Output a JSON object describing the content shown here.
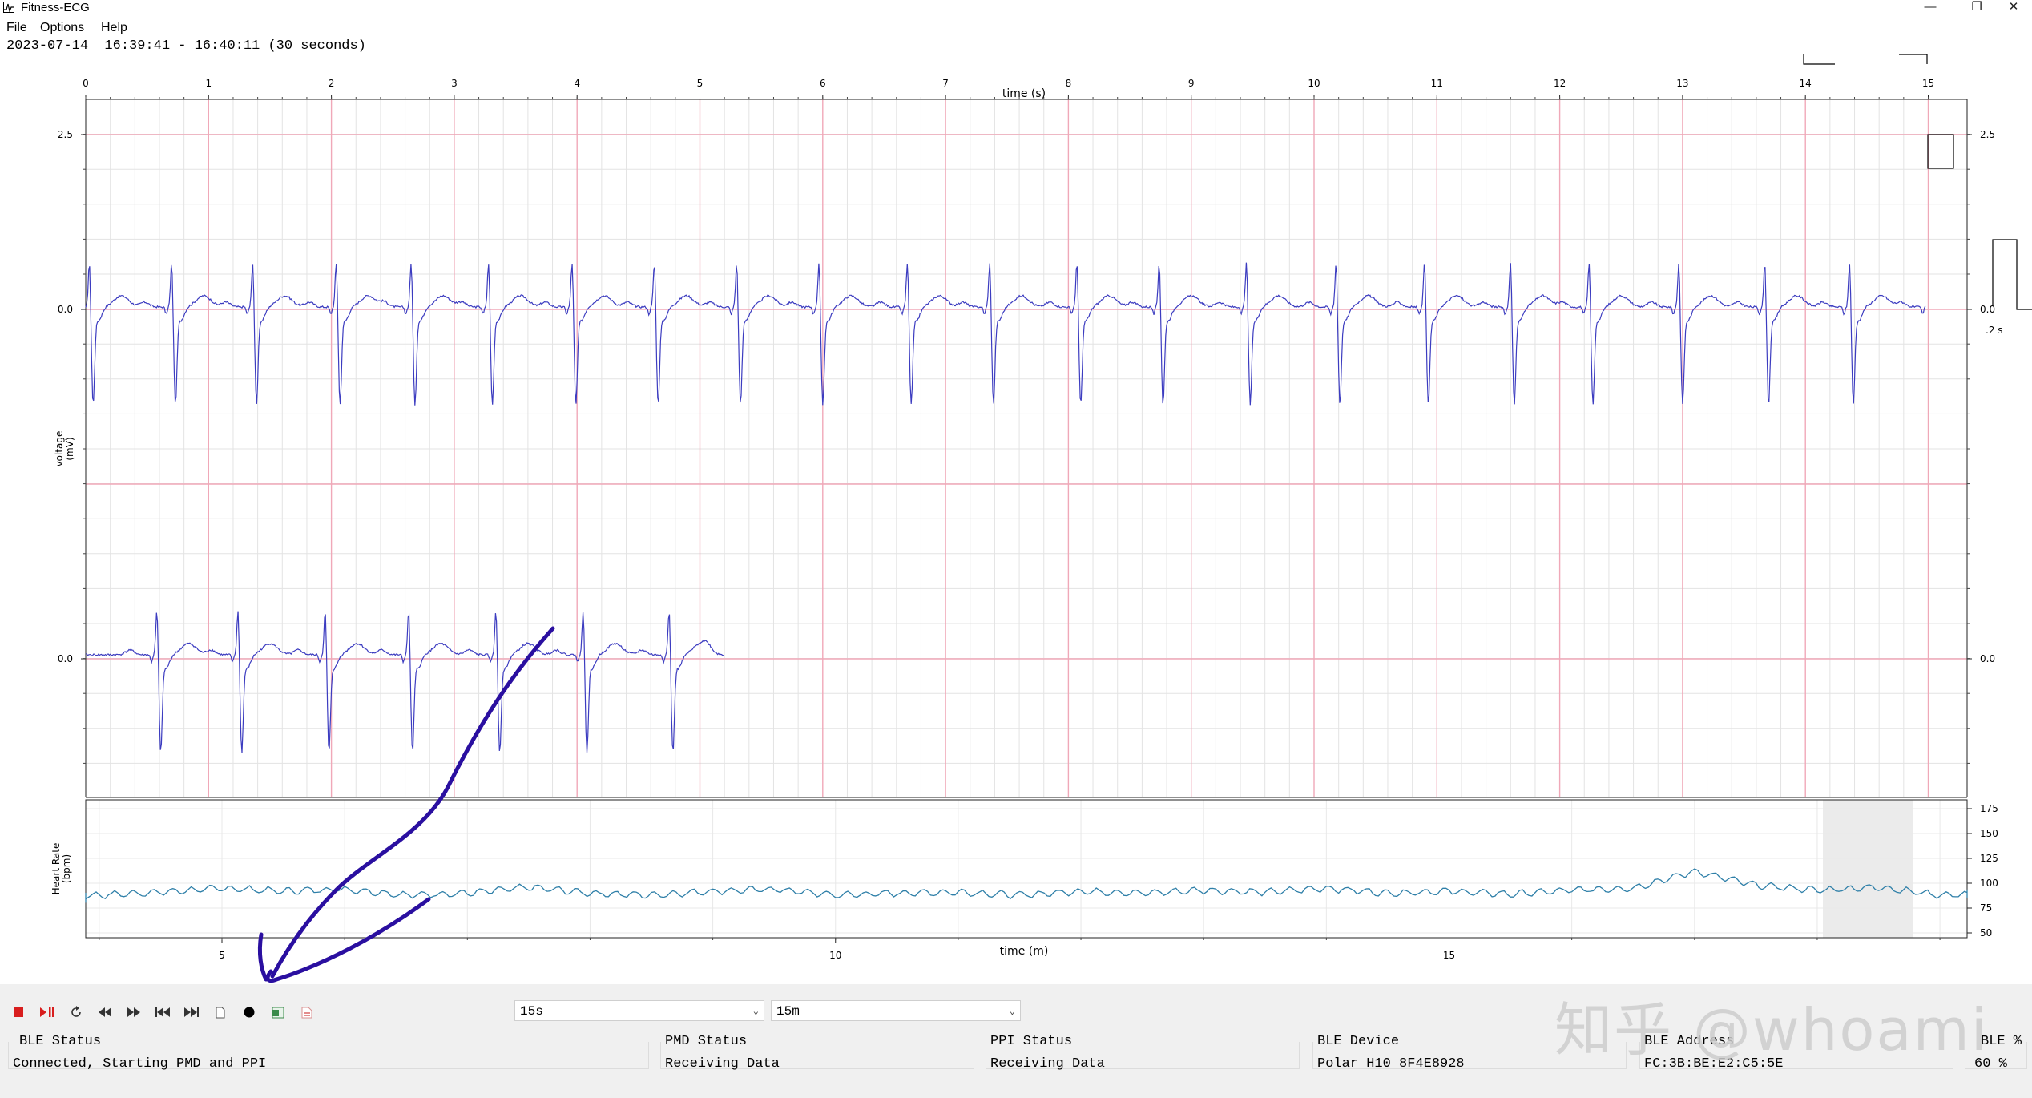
{
  "window": {
    "title": "Fitness-ECG",
    "controls": {
      "minimize": "—",
      "restore": "❐",
      "close": "✕"
    }
  },
  "menu": {
    "items": [
      "File",
      "Options",
      "Help"
    ]
  },
  "session_info": "2023-07-14  16:39:41 - 16:40:11 (30 seconds)",
  "ecg_plot": {
    "xlabel": "time (s)",
    "ylabel": "voltage\n(mV)",
    "x_ticks": [
      "0",
      "1",
      "2",
      "3",
      "4",
      "5",
      "6",
      "7",
      "8",
      "9",
      "10",
      "11",
      "12",
      "13",
      "14",
      "15"
    ],
    "y_tick_labels": [
      "2.5",
      "0.0",
      "0.0"
    ],
    "right_tick_labels": [
      "2.5",
      "0.0",
      "0.0"
    ],
    "calibration_label": ".2 s"
  },
  "hr_plot": {
    "xlabel": "time (m)",
    "ylabel": "Heart Rate\n(bpm)",
    "x_ticks": [
      "5",
      "10",
      "15"
    ],
    "y_ticks": [
      "175",
      "150",
      "125",
      "100",
      "75",
      "50"
    ]
  },
  "chart_data": [
    {
      "type": "line",
      "title": "",
      "xlabel": "time (s)",
      "ylabel": "voltage (mV)",
      "xlim": [
        0,
        15
      ],
      "series": [
        {
          "name": "",
          "x_range": [
            0,
            15
          ],
          "baseline_mV": 0.0,
          "beats_per_15s": 23
        },
        {
          "name": "",
          "x_range": [
            0,
            5.2
          ],
          "baseline_mV": 0.0,
          "beats": 8
        }
      ],
      "grid": true
    },
    {
      "type": "line",
      "title": "",
      "xlabel": "time (m)",
      "ylabel": "Heart Rate (bpm)",
      "ylim": [
        40,
        180
      ],
      "x": [
        2.8,
        3.5,
        4.0,
        4.5,
        5.0,
        5.5,
        6.0,
        6.5,
        7.0,
        7.5,
        8.0,
        8.5,
        9.0,
        9.5,
        10.0,
        10.5,
        11.0,
        11.5,
        12.0,
        12.5,
        13.0,
        13.5,
        14.0,
        14.5,
        15.0,
        15.5,
        16.0,
        16.5,
        17.0,
        17.5,
        18.0,
        18.5,
        19.0,
        19.5,
        20.0
      ],
      "series": [
        {
          "name": "",
          "values": [
            83,
            85,
            88,
            91,
            95,
            92,
            94,
            88,
            90,
            96,
            90,
            88,
            92,
            94,
            88,
            90,
            91,
            88,
            92,
            90,
            93,
            91,
            95,
            90,
            92,
            89,
            93,
            95,
            112,
            98,
            93,
            96,
            88,
            90,
            88
          ]
        }
      ],
      "grid": true
    }
  ],
  "toolbar": {
    "buttons": [
      "stop",
      "play-pause",
      "refresh",
      "rewind",
      "fast-forward",
      "skip-start",
      "skip-end",
      "new-file",
      "record",
      "export-excel",
      "export-pdf"
    ],
    "window_select": "15s",
    "history_select": "15m"
  },
  "status": [
    {
      "title": "BLE Status",
      "value": "Connected, Starting PMD and PPI"
    },
    {
      "title": "PMD Status",
      "value": "Receiving Data"
    },
    {
      "title": "PPI Status",
      "value": "Receiving Data"
    },
    {
      "title": "BLE Device",
      "value": "Polar H10 8F4E8928"
    },
    {
      "title": "BLE Address",
      "value": "FC:3B:BE:E2:C5:5E"
    },
    {
      "title": "BLE %",
      "value": "60 %"
    }
  ],
  "watermark": "知乎 @whoami",
  "colors": {
    "trace": "#3c3cc0",
    "major_grid": "#f0a8b8",
    "minor_grid": "#e3e3e3",
    "hr_line": "#2e7fa8",
    "annotation": "#2a0fa0"
  }
}
